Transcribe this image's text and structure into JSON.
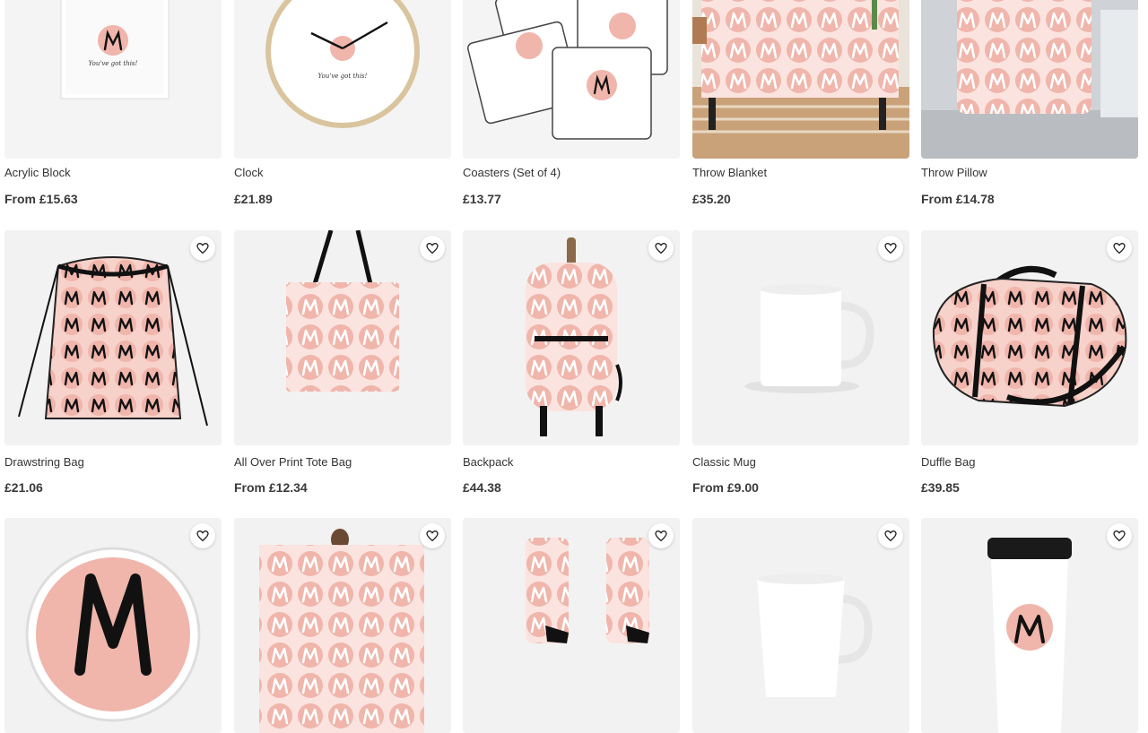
{
  "products": [
    {
      "name": "Acrylic Block",
      "price": "From £15.63"
    },
    {
      "name": "Clock",
      "price": "£21.89"
    },
    {
      "name": "Coasters (Set of 4)",
      "price": "£13.77"
    },
    {
      "name": "Throw Blanket",
      "price": "£35.20"
    },
    {
      "name": "Throw Pillow",
      "price": "From £14.78"
    },
    {
      "name": "Drawstring Bag",
      "price": "£21.06"
    },
    {
      "name": "All Over Print Tote Bag",
      "price": "From £12.34"
    },
    {
      "name": "Backpack",
      "price": "£44.38"
    },
    {
      "name": "Classic Mug",
      "price": "From £9.00"
    },
    {
      "name": "Duffle Bag",
      "price": "£39.85"
    }
  ],
  "artwork": {
    "logo_letter": "M",
    "tagline": "You've got this!"
  },
  "icons": {
    "favorite": "heart-outline-icon"
  },
  "colors": {
    "accent_pink": "#f0b5ab",
    "ink": "#111111",
    "card_bg": "#f2f2f2"
  }
}
